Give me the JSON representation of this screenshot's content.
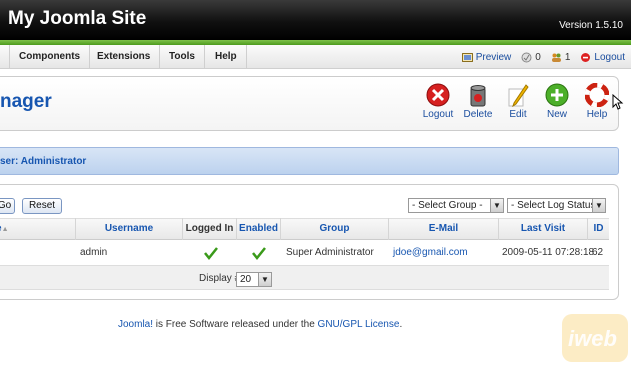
{
  "header": {
    "site_title": "My Joomla Site",
    "version": "Version 1.5.10"
  },
  "menu": {
    "items": [
      "Components",
      "Extensions",
      "Tools",
      "Help"
    ],
    "preview": "Preview",
    "messages_count": "0",
    "users_count": "1",
    "logout": "Logout"
  },
  "toolbar": {
    "title_fragment": "nager",
    "buttons": [
      {
        "label": "Logout",
        "icon": "logout-icon"
      },
      {
        "label": "Delete",
        "icon": "trash-icon"
      },
      {
        "label": "Edit",
        "icon": "edit-pencil-icon"
      },
      {
        "label": "New",
        "icon": "new-plus-icon"
      },
      {
        "label": "Help",
        "icon": "help-lifebuoy-icon"
      }
    ]
  },
  "band": {
    "user_fragment": "ser: Administrator"
  },
  "filters": {
    "go": "Go",
    "reset": "Reset",
    "select_group": "- Select Group -",
    "select_log_status": "- Select Log Status -"
  },
  "table": {
    "headers": {
      "name_fragment": "e",
      "username": "Username",
      "logged_in": "Logged In",
      "enabled": "Enabled",
      "group": "Group",
      "email": "E-Mail",
      "last_visit": "Last Visit",
      "id": "ID"
    },
    "rows": [
      {
        "username": "admin",
        "logged_in": true,
        "enabled": true,
        "group": "Super Administrator",
        "email": "jdoe@gmail.com",
        "last_visit": "2009-05-11 07:28:18",
        "id": "62"
      }
    ]
  },
  "pagination": {
    "display_label": "Display #",
    "display_value": "20"
  },
  "footer": {
    "joomla": "Joomla!",
    "middle": " is Free Software released under the ",
    "license": "GNU/GPL License",
    "end": "."
  },
  "colors": {
    "accent_green": "#4d9a1e",
    "link_blue": "#1756b0",
    "band_blue": "#bcd2ee"
  }
}
